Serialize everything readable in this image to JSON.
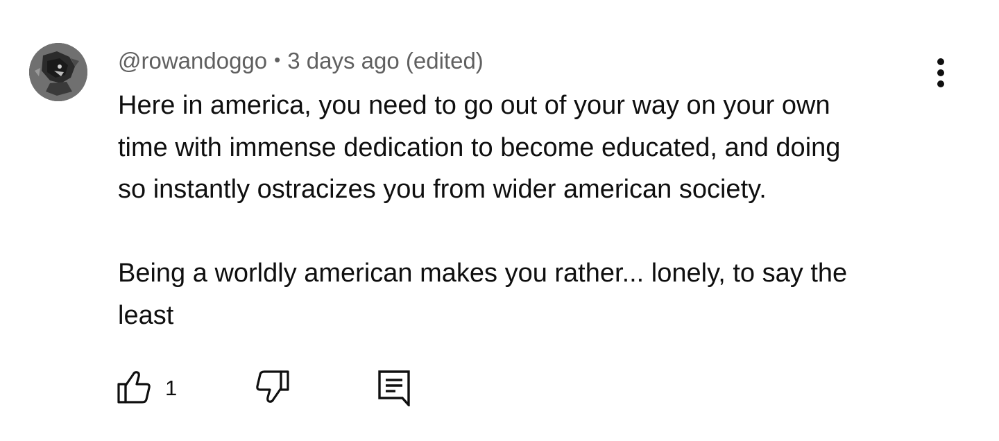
{
  "comment": {
    "author": "@rowandoggo",
    "separator": "•",
    "time": "3 days ago (edited)",
    "text": "Here in america, you need to go out of your way on your own\ntime with immense dedication to become educated, and doing\nso instantly ostracizes you from wider american society.\n\nBeing a worldly american makes you rather... lonely, to say the\nleast",
    "like_count": "1"
  },
  "icons": {
    "avatar": "avatar-image",
    "more": "more-vert-icon",
    "like": "thumb-up-icon",
    "dislike": "thumb-down-icon",
    "reply": "reply-comment-icon"
  },
  "colors": {
    "text": "#0f0f0f",
    "meta": "#606060",
    "background": "#ffffff"
  }
}
